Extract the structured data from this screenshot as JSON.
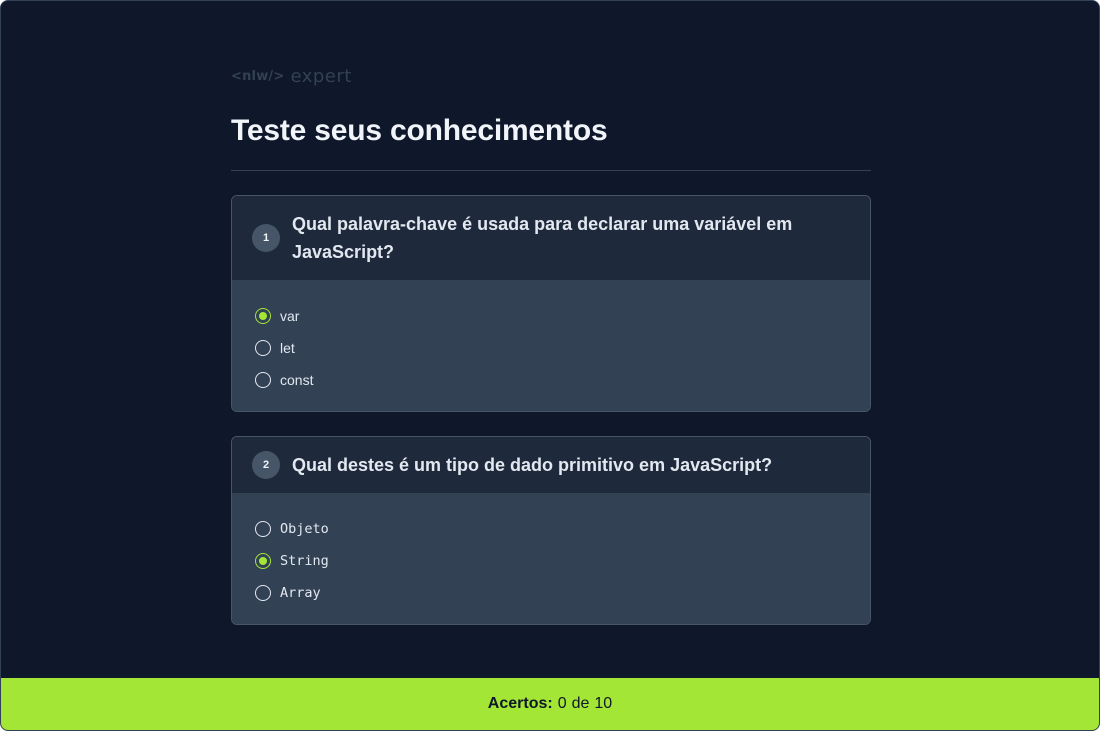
{
  "header": {
    "logo_tag": "<nlw/>",
    "logo_word": "expert",
    "title": "Teste seus conhecimentos"
  },
  "questions": [
    {
      "number": "1",
      "text": "Qual palavra-chave é usada para declarar uma variável em JavaScript?",
      "options": [
        {
          "label": "var",
          "selected": true
        },
        {
          "label": "let",
          "selected": false
        },
        {
          "label": "const",
          "selected": false
        }
      ]
    },
    {
      "number": "2",
      "text": "Qual destes é um tipo de dado primitivo em JavaScript?",
      "options": [
        {
          "label": "Objeto",
          "selected": false
        },
        {
          "label": "String",
          "selected": true
        },
        {
          "label": "Array",
          "selected": false
        }
      ]
    }
  ],
  "footer": {
    "label": "Acertos:",
    "correct": "0",
    "separator": "de",
    "total": "10"
  },
  "colors": {
    "background": "#0f172a",
    "card_header": "#1e293b",
    "card_body": "#334155",
    "accent": "#a3e635"
  }
}
